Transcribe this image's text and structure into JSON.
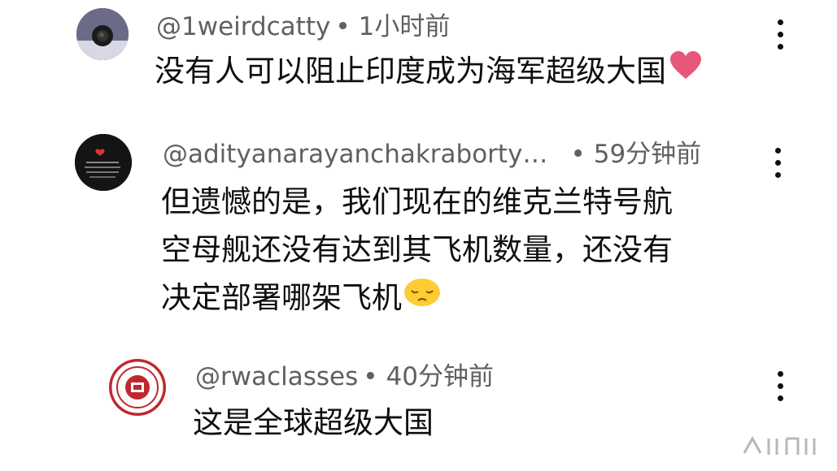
{
  "comments": [
    {
      "author": "@1weirdcatty",
      "separator": "•",
      "time": "1小时前",
      "text_lines": [
        "没有人可以阻止印度成为海军超级大国"
      ],
      "emoji": "heart-emoji"
    },
    {
      "author": "@adityanarayanchakraborty…",
      "separator": "•",
      "time": "59分钟前",
      "text_lines": [
        "但遗憾的是，我们现在的维克兰特号航",
        "空母舰还没有达到其飞机数量，还没有",
        "决定部署哪架飞机"
      ],
      "emoji": "sad-face-emoji"
    },
    {
      "author": "@rwaclasses",
      "separator": "•",
      "time": "40分钟前",
      "text_lines": [
        "这是全球超级大国"
      ],
      "emoji": ""
    }
  ],
  "icons": {
    "more": "more-vertical-icon",
    "watermark": "platform-watermark-logo"
  },
  "colors": {
    "text": "#0f0f0f",
    "meta": "#606060",
    "heart": "#e9567b",
    "emoji_yellow": "#ffcc33",
    "rwa_red": "#c0272d"
  }
}
